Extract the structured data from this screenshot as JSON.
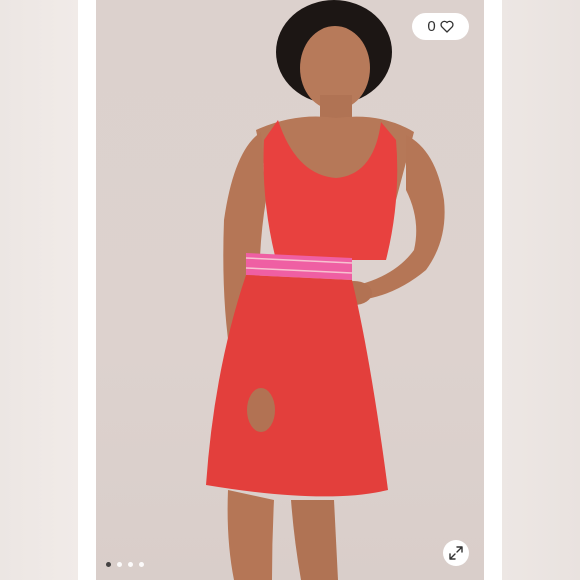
{
  "listing": {
    "like_count": "0",
    "colors": {
      "dress": "#e8413f",
      "waistband": "#ef5fa3",
      "background": "#dcd1cd"
    }
  },
  "carousel": {
    "dots": [
      {
        "active": true
      },
      {
        "active": false
      },
      {
        "active": false
      },
      {
        "active": false
      }
    ]
  },
  "icons": {
    "like": "heart-icon",
    "expand": "expand-arrows-icon"
  }
}
